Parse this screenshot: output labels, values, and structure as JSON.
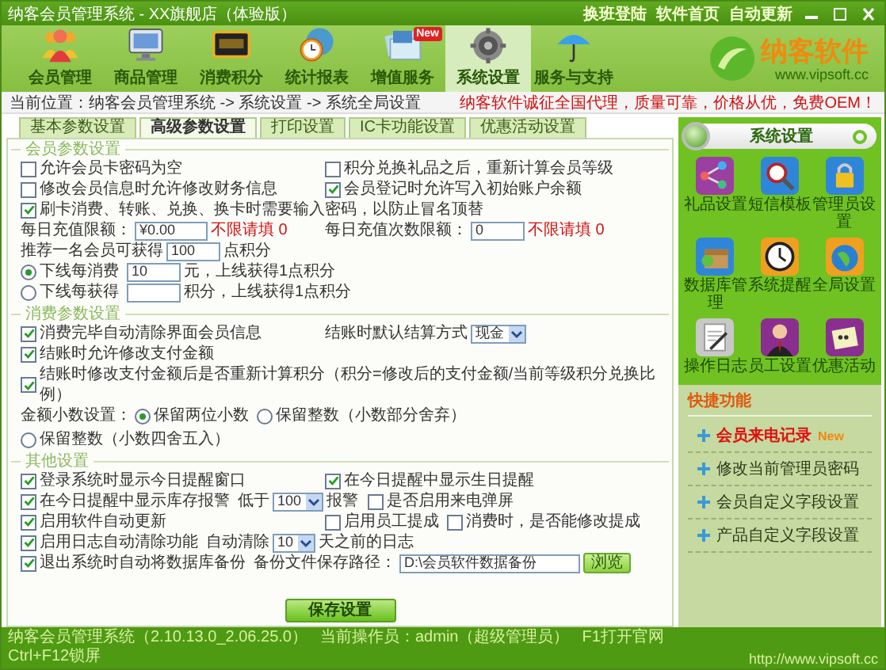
{
  "window": {
    "title": "纳客会员管理系统 - XX旗舰店（体验版）",
    "links": [
      "换班登陆",
      "软件首页",
      "自动更新"
    ]
  },
  "nav": [
    {
      "label": "会员管理",
      "selected": false
    },
    {
      "label": "商品管理",
      "selected": false
    },
    {
      "label": "消费积分",
      "selected": false
    },
    {
      "label": "统计报表",
      "selected": false
    },
    {
      "label": "增值服务",
      "selected": false,
      "badge": "New"
    },
    {
      "label": "系统设置",
      "selected": true
    },
    {
      "label": "服务与支持",
      "selected": false
    }
  ],
  "logo": {
    "name": "纳客软件",
    "url": "www.vipsoft.cc"
  },
  "breadcrumb": {
    "path": "当前位置：纳客会员管理系统 -> 系统设置 -> 系统全局设置",
    "notice": "纳客软件诚征全国代理，质量可靠，价格从优，免费OEM！"
  },
  "tabs": [
    {
      "label": "基本参数设置",
      "selected": false
    },
    {
      "label": "高级参数设置",
      "selected": true
    },
    {
      "label": "打印设置",
      "selected": false
    },
    {
      "label": "IC卡功能设置",
      "selected": false
    },
    {
      "label": "优惠活动设置",
      "selected": false
    }
  ],
  "groups": [
    {
      "legend": "会员参数设置",
      "rows": [
        {
          "cols": [
            [
              {
                "kind": "checkbox",
                "label": "允许会员卡密码为空",
                "checked": false
              }
            ],
            [
              {
                "kind": "checkbox",
                "label": "积分兑换礼品之后，重新计算会员等级",
                "checked": false
              }
            ]
          ]
        },
        {
          "cols": [
            [
              {
                "kind": "checkbox",
                "label": "修改会员信息时允许修改财务信息",
                "checked": false
              }
            ],
            [
              {
                "kind": "checkbox",
                "label": "会员登记时允许写入初始账户余额",
                "checked": true
              }
            ]
          ]
        },
        {
          "cols": [
            [
              {
                "kind": "checkbox",
                "label": "刷卡消费、转账、兑换、换卡时需要输入密码，以防止冒名顶替",
                "checked": true
              }
            ]
          ]
        },
        {
          "cols": [
            [
              {
                "kind": "text",
                "text": "每日充值限额："
              },
              {
                "kind": "input",
                "value": "¥0.00"
              },
              {
                "kind": "note",
                "text": "不限请填 0"
              }
            ],
            [
              {
                "kind": "text",
                "text": "每日充值次数限额："
              },
              {
                "kind": "input",
                "value": "0"
              },
              {
                "kind": "note",
                "text": "不限请填 0"
              }
            ]
          ]
        },
        {
          "cols": [
            [
              {
                "kind": "text",
                "text": "推荐一名会员可获得"
              },
              {
                "kind": "input",
                "value": "100"
              },
              {
                "kind": "text",
                "text": "点积分"
              }
            ]
          ]
        },
        {
          "cols": [
            [
              {
                "kind": "radio",
                "label": "下线每消费",
                "selected": true
              },
              {
                "kind": "input",
                "value": "10"
              },
              {
                "kind": "text",
                "text": "元，上线获得1点积分"
              }
            ],
            [
              {
                "kind": "radio",
                "label": "下线每获得",
                "selected": false
              },
              {
                "kind": "input"
              },
              {
                "kind": "text",
                "text": "积分，上线获得1点积分"
              }
            ]
          ]
        }
      ]
    },
    {
      "legend": "消费参数设置",
      "rows": [
        {
          "cols": [
            [
              {
                "kind": "checkbox",
                "label": "消费完毕自动清除界面会员信息",
                "checked": true
              }
            ],
            [
              {
                "kind": "text",
                "text": "结账时默认结算方式"
              },
              {
                "kind": "select",
                "value": "现金"
              }
            ]
          ]
        },
        {
          "cols": [
            [
              {
                "kind": "checkbox",
                "label": "结账时允许修改支付金额",
                "checked": true
              }
            ]
          ]
        },
        {
          "cols": [
            [
              {
                "kind": "checkbox",
                "label": "结账时修改支付金额后是否重新计算积分（积分=修改后的支付金额/当前等级积分兑换比例）",
                "checked": true
              }
            ]
          ]
        },
        {
          "cols": [
            [
              {
                "kind": "text",
                "text": "金额小数设置："
              },
              {
                "kind": "radio",
                "label": "保留两位小数",
                "selected": true
              },
              {
                "kind": "radio",
                "label": "保留整数（小数部分舍弃）",
                "selected": false
              },
              {
                "kind": "radio",
                "label": "保留整数（小数四舍五入）",
                "selected": false
              }
            ]
          ]
        }
      ]
    },
    {
      "legend": "其他设置",
      "rows": [
        {
          "cols": [
            [
              {
                "kind": "checkbox",
                "label": "登录系统时显示今日提醒窗口",
                "checked": true
              }
            ],
            [
              {
                "kind": "checkbox",
                "label": "在今日提醒中显示生日提醒",
                "checked": true
              }
            ]
          ]
        },
        {
          "cols": [
            [
              {
                "kind": "checkbox",
                "label": "在今日提醒中显示库存报警",
                "checked": true
              },
              {
                "kind": "text",
                "text": "低于"
              },
              {
                "kind": "select",
                "value": "100"
              },
              {
                "kind": "text",
                "text": "报警"
              }
            ],
            [
              {
                "kind": "checkbox",
                "label": "是否启用来电弹屏",
                "checked": false
              }
            ]
          ]
        },
        {
          "cols": [
            [
              {
                "kind": "checkbox",
                "label": "启用软件自动更新",
                "checked": true
              }
            ],
            [
              {
                "kind": "checkbox",
                "label": "启用员工提成",
                "checked": false
              },
              {
                "kind": "checkbox",
                "label": "消费时，是否能修改提成",
                "checked": false
              }
            ]
          ]
        },
        {
          "cols": [
            [
              {
                "kind": "checkbox",
                "label": "启用日志自动清除功能",
                "checked": true
              },
              {
                "kind": "text",
                "text": "自动清除"
              },
              {
                "kind": "select",
                "value": "10"
              },
              {
                "kind": "text",
                "text": "天之前的日志"
              }
            ]
          ]
        },
        {
          "cols": [
            [
              {
                "kind": "checkbox",
                "label": "退出系统时自动将数据库备份",
                "checked": true
              },
              {
                "kind": "text",
                "text": "备份文件保存路径："
              },
              {
                "kind": "input",
                "value": "D:\\会员软件数据备份"
              },
              {
                "kind": "button",
                "label": "浏览"
              }
            ]
          ]
        }
      ]
    }
  ],
  "save_button": "保存设置",
  "side_panel": {
    "title": "系统设置",
    "items": [
      "礼品设置",
      "短信模板",
      "管理员设置",
      "数据库管理",
      "系统提醒",
      "全局设置",
      "操作日志",
      "员工设置",
      "优惠活动"
    ],
    "quick_title": "快捷功能",
    "quick_links": [
      {
        "label": "会员来电记录",
        "selected": true,
        "badge": "New"
      },
      {
        "label": "修改当前管理员密码",
        "selected": false
      },
      {
        "label": "会员自定义字段设置",
        "selected": false
      },
      {
        "label": "产品自定义字段设置",
        "selected": false
      }
    ]
  },
  "status_bar": {
    "items": [
      "纳客会员管理系统（2.10.13.0_2.06.25.0）",
      "当前操作员：admin（超级管理员）",
      "F1打开官网",
      "Ctrl+F12锁屏"
    ],
    "url": "http://www.vipsoft.cc"
  }
}
